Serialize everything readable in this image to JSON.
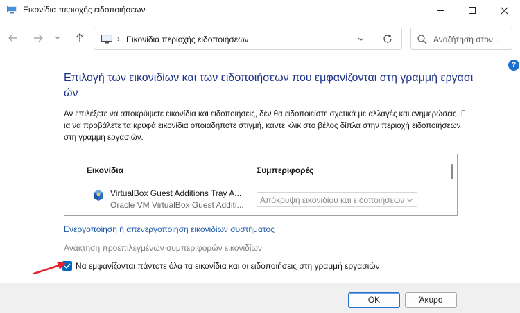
{
  "window": {
    "title": "Εικονίδια περιοχής ειδοποιήσεων"
  },
  "navbar": {
    "breadcrumb_separator": "›",
    "address": "Εικονίδια περιοχής ειδοποιήσεων",
    "search_placeholder": "Αναζήτηση στον ..."
  },
  "help": {
    "label": "?"
  },
  "content": {
    "heading": "Επιλογή των εικονιδίων και των ειδοποιήσεων που εμφανίζονται στη γραμμή εργασιών",
    "description": "Αν επιλέξετε να αποκρύψετε εικονίδια και ειδοποιήσεις, δεν θα ειδοποιείστε σχετικά με αλλαγές και ενημερώσεις. Για να προβάλετε τα κρυφά εικονίδια οποιαδήποτε στιγμή, κάντε κλικ στο βέλος δίπλα στην περιοχή ειδοποιήσεων στη γραμμή εργασιών."
  },
  "list": {
    "columns": [
      "Εικονίδια",
      "Συμπεριφορές"
    ],
    "rows": [
      {
        "name": "VirtualBox Guest Additions Tray A...",
        "publisher": "Oracle VM VirtualBox Guest Additi...",
        "behavior": "Απόκρυψη εικονιδίου και ειδοποιήσεων"
      }
    ]
  },
  "links": {
    "system_icons": "Ενεργοποίηση ή απενεργοποίηση εικονιδίων συστήματος",
    "restore_defaults": "Ανάκτηση προεπιλεγμένων συμπεριφορών εικονιδίων"
  },
  "checkbox": {
    "label": "Να εμφανίζονται πάντοτε όλα τα εικονίδια και οι ειδοποιήσεις στη γραμμή εργασιών",
    "checked": true
  },
  "footer": {
    "ok_label": "OK",
    "cancel_label": "Άκυρο"
  },
  "colors": {
    "heading": "#1e3287",
    "link": "#1e5aa8",
    "checkbox": "#0067c0",
    "annotation_arrow": "#e8202a"
  }
}
